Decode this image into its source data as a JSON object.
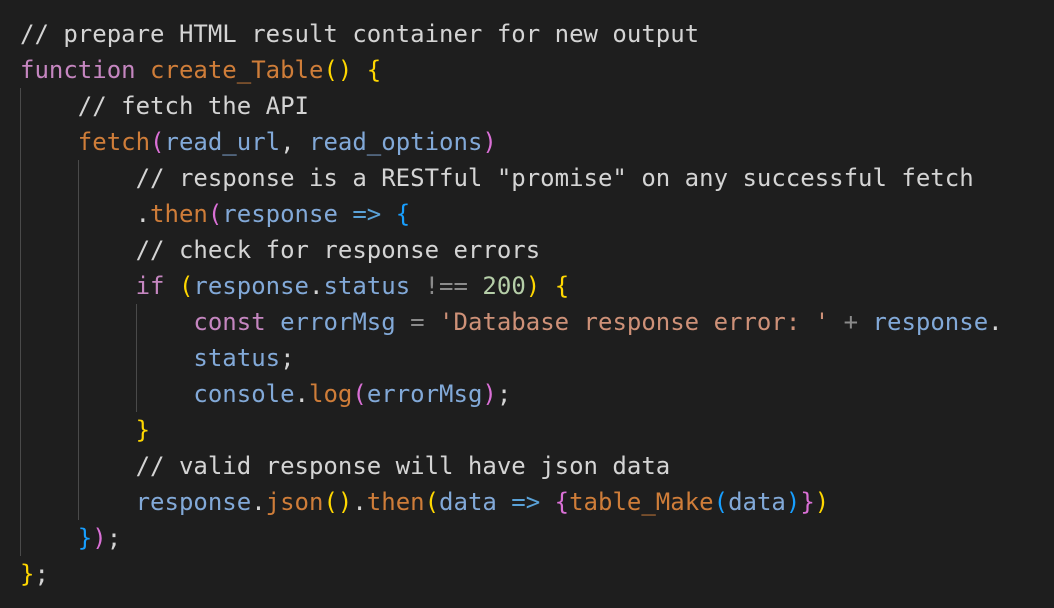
{
  "editor": {
    "lines": [
      "// prepare HTML result container for new output",
      "function create_Table() {",
      "    // fetch the API",
      "    fetch(read_url, read_options)",
      "        // response is a RESTful \"promise\" on any successful fetch",
      "        .then(response => {",
      "        // check for response errors",
      "        if (response.status !== 200) {",
      "            const errorMsg = 'Database response error: ' + response.",
      "            status;",
      "            console.log(errorMsg);",
      "        }",
      "        // valid response will have json data",
      "        response.json().then(data => {table_Make(data)})",
      "    });",
      "};"
    ]
  },
  "colors": {
    "background": "#1e1e1e",
    "comment": "#d4d4d4",
    "keyword": "#c586c0",
    "function": "#cf7d39",
    "variable": "#82a9d8",
    "string": "#ce9178",
    "number": "#b5cea8",
    "bracket_level1": "#ffd700",
    "bracket_level2": "#da70d6",
    "bracket_level3": "#179fff"
  }
}
